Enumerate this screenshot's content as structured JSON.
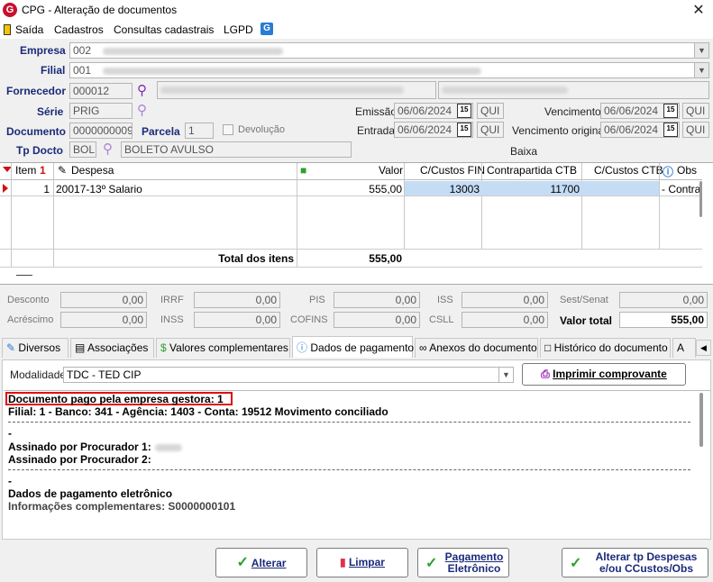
{
  "window": {
    "title": "CPG - Alteração de documentos",
    "app_icon": "G",
    "close": "✕"
  },
  "menu": {
    "items": [
      "Saída",
      "Cadastros",
      "Consultas cadastrais",
      "LGPD"
    ]
  },
  "form": {
    "empresa_label": "Empresa",
    "empresa_value": "002",
    "filial_label": "Filial",
    "filial_value": "001",
    "fornecedor_label": "Fornecedor",
    "fornecedor_value": "000012",
    "serie_label": "Série",
    "serie_value": "PRIG",
    "documento_label": "Documento",
    "documento_value": "0000000009",
    "parcela_label": "Parcela",
    "parcela_value": "1",
    "devolucao_label": "Devolução",
    "tpdocto_label": "Tp Docto",
    "tpdocto_code": "BOL",
    "tpdocto_desc": "BOLETO AVULSO",
    "emissao_label": "Emissão",
    "emissao_value": "06/06/2024",
    "emissao_day": "QUI",
    "entrada_label": "Entrada",
    "entrada_value": "06/06/2024",
    "entrada_day": "QUI",
    "vencimento_label": "Vencimento",
    "vencimento_value": "06/06/2024",
    "vencimento_day": "QUI",
    "venc_original_label": "Vencimento original",
    "venc_original_value": "06/06/2024",
    "venc_original_day": "QUI",
    "baixa_label": "Baixa",
    "cal_glyph": "15"
  },
  "grid": {
    "headers": {
      "item": "Item",
      "sort_mark": "1",
      "despesa": "Despesa",
      "valor": "Valor",
      "ccustos_fin": "C/Custos FIN",
      "contrapartida": "Contrapartida CTB",
      "ccustos_ctb": "C/Custos CTB",
      "obs": "Obs"
    },
    "rows": [
      {
        "item": "1",
        "despesa": "20017-13º Salario",
        "valor": "555,00",
        "ccustos_fin": "13003",
        "contrapartida": "11700",
        "ccustos_ctb": "",
        "obs": "- Contra"
      }
    ],
    "total_label": "Total dos itens",
    "total_value": "555,00"
  },
  "totals": {
    "desconto_label": "Desconto",
    "desconto": "0,00",
    "acrescimo_label": "Acréscimo",
    "acrescimo": "0,00",
    "irrf_label": "IRRF",
    "irrf": "0,00",
    "inss_label": "INSS",
    "inss": "0,00",
    "pis_label": "PIS",
    "pis": "0,00",
    "cofins_label": "COFINS",
    "cofins": "0,00",
    "iss_label": "ISS",
    "iss": "0,00",
    "csll_label": "CSLL",
    "csll": "0,00",
    "sest_label": "Sest/Senat",
    "sest": "0,00",
    "valor_total_label": "Valor total",
    "valor_total": "555,00"
  },
  "tabs": [
    "Diversos",
    "Associações",
    "Valores complementares",
    "Dados de pagamento",
    "Anexos do documento",
    "Histórico do documento",
    "A"
  ],
  "payment": {
    "modalidade_label": "Modalidade",
    "modalidade_value": "TDC - TED CIP",
    "print_button": "Imprimir comprovante",
    "line1": "Documento pago pela empresa gestora: 1",
    "line2": "Filial: 1 - Banco: 341 - Agência: 1403 - Conta: 19512 Movimento conciliado",
    "dash1": "-",
    "line3": "Assinado por Procurador 1:",
    "line4": "Assinado por Procurador 2:",
    "dash2": "-",
    "line5": "Dados de pagamento eletrônico",
    "line6": "Informações complementares: S0000000101"
  },
  "buttons": {
    "alterar": "Alterar",
    "limpar": "Limpar",
    "pagamento_1": "Pagamento",
    "pagamento_2": "Eletrônico",
    "alterar_tp_1": "Alterar tp Despesas",
    "alterar_tp_2": "e/ou CCustos/Obs"
  },
  "colors": {
    "label_blue": "#1a2a7a",
    "highlight_red": "#e01010",
    "selected_row": "#c5dcf5",
    "accent_green": "#2da02d"
  }
}
